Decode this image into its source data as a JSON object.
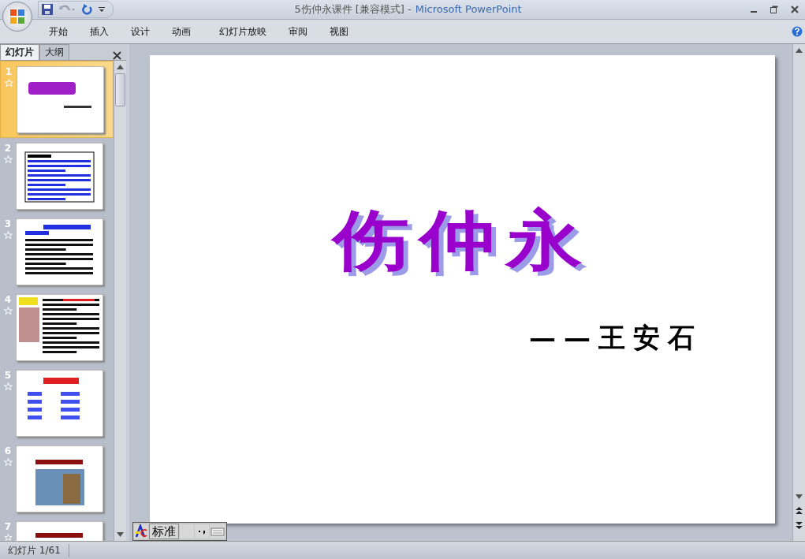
{
  "window": {
    "title": "5伤仲永课件 [兼容模式] -",
    "app_name": "Microsoft PowerPoint"
  },
  "ribbon_tabs": [
    {
      "label": "开始",
      "selected": false
    },
    {
      "label": "插入",
      "selected": false
    },
    {
      "label": "设计",
      "selected": false
    },
    {
      "label": "动画",
      "selected": false
    },
    {
      "label": "幻灯片放映",
      "selected": false
    },
    {
      "label": "审阅",
      "selected": false
    },
    {
      "label": "视图",
      "selected": false
    }
  ],
  "pane_tabs": [
    {
      "label": "幻灯片",
      "selected": true
    },
    {
      "label": "大纲",
      "selected": false
    }
  ],
  "thumbnails": [
    {
      "number": "1",
      "kind": "title",
      "selected": true
    },
    {
      "number": "2",
      "kind": "framed-text",
      "selected": false
    },
    {
      "number": "3",
      "kind": "text",
      "selected": false
    },
    {
      "number": "4",
      "kind": "portrait",
      "selected": false
    },
    {
      "number": "5",
      "kind": "list",
      "selected": false
    },
    {
      "number": "6",
      "kind": "picture",
      "selected": false
    },
    {
      "number": "7",
      "kind": "partial",
      "selected": false
    }
  ],
  "slide": {
    "title": "伤仲永",
    "subtitle": "——王安石"
  },
  "ime_toolbar": {
    "mode": "标准"
  },
  "status_bar": {
    "slide_counter": "幻灯片 1/61"
  }
}
